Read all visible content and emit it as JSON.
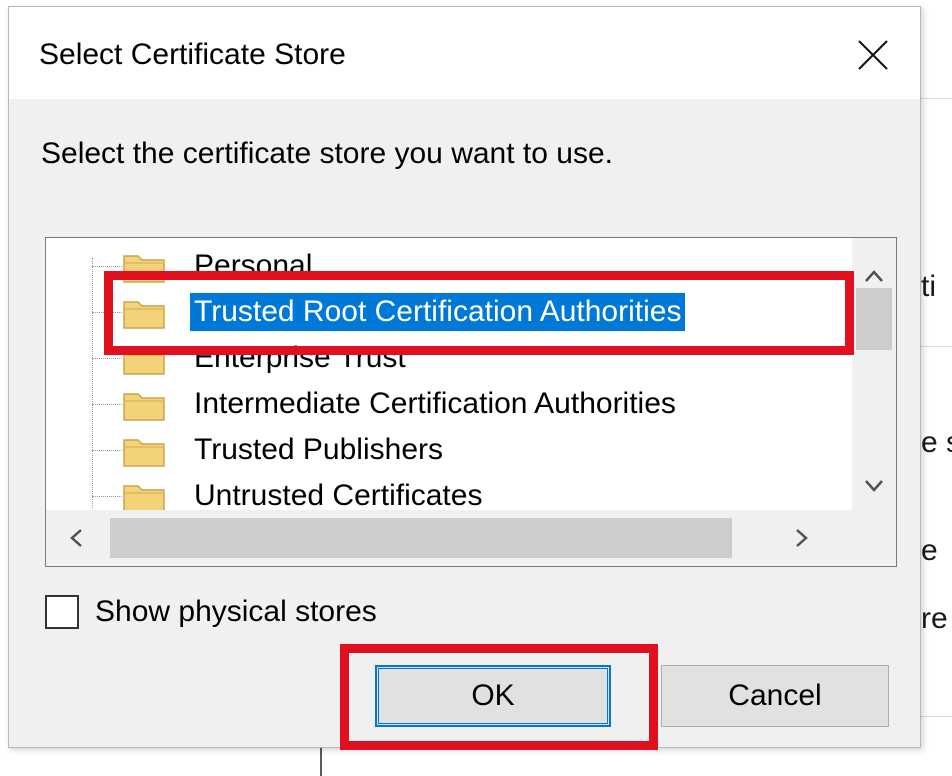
{
  "dialog": {
    "title": "Select Certificate Store",
    "instruction": "Select the certificate store you want to use."
  },
  "tree": {
    "items": [
      {
        "label": "Personal",
        "selected": false
      },
      {
        "label": "Trusted Root Certification Authorities",
        "selected": true
      },
      {
        "label": "Enterprise Trust",
        "selected": false
      },
      {
        "label": "Intermediate Certification Authorities",
        "selected": false
      },
      {
        "label": "Trusted Publishers",
        "selected": false
      },
      {
        "label": "Untrusted Certificates",
        "selected": false
      }
    ]
  },
  "options": {
    "show_physical_stores_label": "Show physical stores",
    "show_physical_stores_checked": false
  },
  "buttons": {
    "ok_label": "OK",
    "cancel_label": "Cancel"
  },
  "background_window": {
    "fragments": [
      "ti",
      "e s",
      "e",
      "re"
    ]
  },
  "colors": {
    "selection": "#0078d7",
    "highlight": "#e0101f",
    "folder": "#f3d27a"
  },
  "icons": {
    "close": "close-icon",
    "folder": "folder-icon",
    "scroll_up": "chevron-up-icon",
    "scroll_down": "chevron-down-icon",
    "scroll_left": "chevron-left-icon",
    "scroll_right": "chevron-right-icon"
  }
}
